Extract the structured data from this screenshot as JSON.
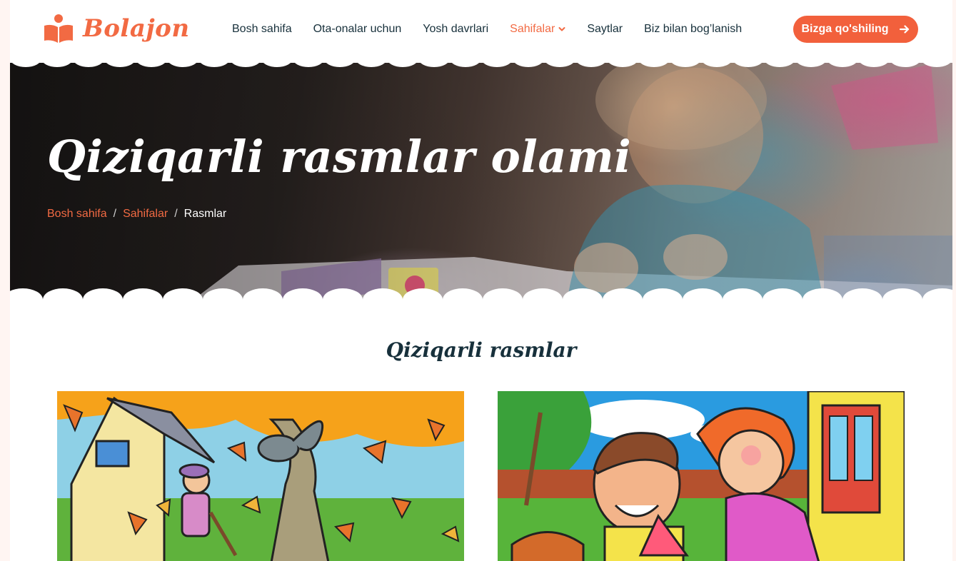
{
  "brand": {
    "name": "Bolajon",
    "color": "#f26a43",
    "icon": "book-reader-icon"
  },
  "nav": {
    "items": [
      {
        "label": "Bosh sahifa"
      },
      {
        "label": "Ota-onalar uchun"
      },
      {
        "label": "Yosh davrlari"
      },
      {
        "label": "Sahifalar",
        "active": true,
        "has_dropdown": true
      },
      {
        "label": "Saytlar"
      },
      {
        "label": "Biz bilan bog’lanish"
      }
    ],
    "cta_label": "Bizga qo'shiling"
  },
  "hero": {
    "title": "Qiziqarli rasmlar olami",
    "breadcrumb": [
      "Bosh sahifa",
      "Sahifalar",
      "Rasmlar"
    ]
  },
  "section": {
    "title": "Qiziqarli rasmlar"
  },
  "gallery": [
    {
      "name": "autumn-yard-picture"
    },
    {
      "name": "family-garden-picture"
    }
  ]
}
